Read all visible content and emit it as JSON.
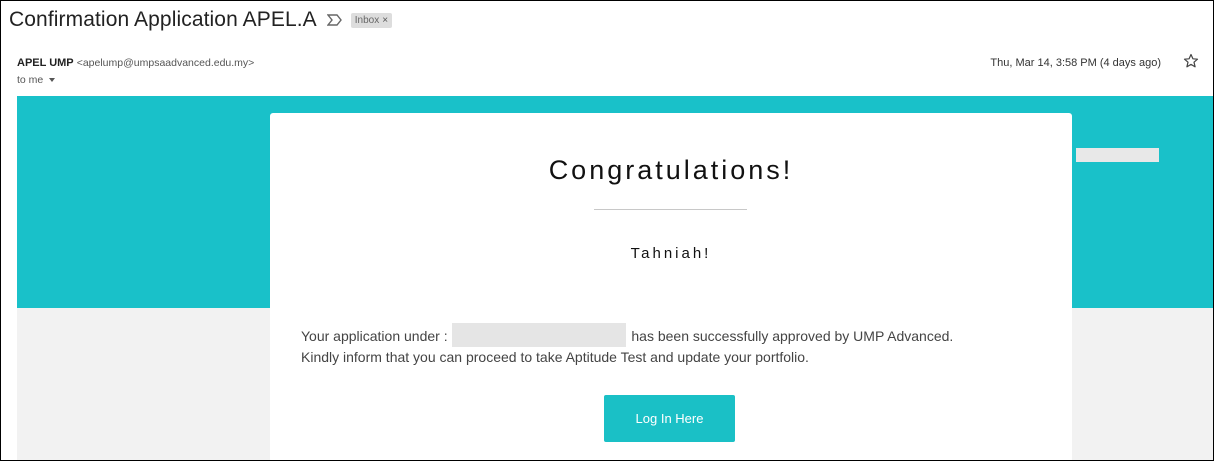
{
  "email": {
    "subject": "Confirmation Application APEL.A",
    "label_chip": "Inbox",
    "label_chip_close": "×",
    "sender_name": "APEL UMP",
    "sender_email": "<apelump@umpsaadvanced.edu.my>",
    "recipient": "to me",
    "date": "Thu, Mar 14, 3:58 PM (4 days ago)"
  },
  "content": {
    "heading": "Congratulations!",
    "subheading": "Tahniah!",
    "paragraph_part1": "Your application under :",
    "paragraph_part2": "has been successfully approved by UMP Advanced.",
    "paragraph_line2": "Kindly inform that you can proceed to take Aptitude Test and update your portfolio.",
    "button_label": "Log In Here"
  },
  "colors": {
    "teal": "#19c1c9",
    "button": "#1ac0c6",
    "gray_band": "#f2f2f2"
  },
  "icons": {
    "important_marker": "important-marker-icon",
    "star": "star-icon",
    "dropdown": "chevron-down-icon"
  }
}
